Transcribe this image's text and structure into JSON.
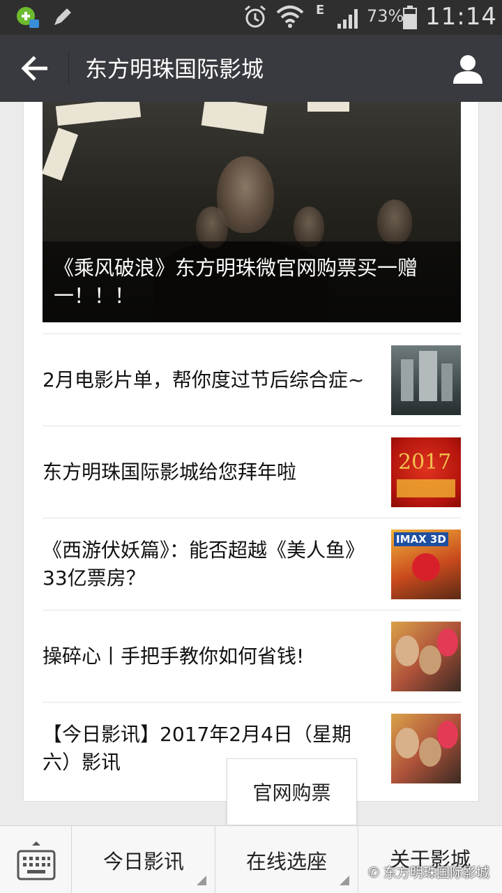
{
  "status_bar": {
    "network_label": "E",
    "battery_percent": "73%",
    "time": "11:14"
  },
  "header": {
    "title": "东方明珠国际影城"
  },
  "banner": {
    "caption": "《乘风破浪》东方明珠微官网购票买一赠一！！！"
  },
  "articles": [
    {
      "title": "2月电影片单，帮你度过节后综合症~",
      "thumb_icon": "city-poster-thumbnail"
    },
    {
      "title": "东方明珠国际影城给您拜年啦",
      "thumb_icon": "new-year-2017-thumbnail",
      "thumb_text": "2017"
    },
    {
      "title": "《西游伏妖篇》：能否超越《美人鱼》33亿票房？",
      "thumb_icon": "movie-poster-thumbnail",
      "thumb_text": "IMAX 3D"
    },
    {
      "title": "操碎心丨手把手教你如何省钱!",
      "thumb_icon": "movie-cast-thumbnail"
    },
    {
      "title": "【今日影讯】2017年2月4日（星期六）影讯",
      "thumb_icon": "movie-cast-thumbnail"
    }
  ],
  "popup_menu": {
    "item": "官网购票"
  },
  "bottom_menu": {
    "tabs": [
      "今日影讯",
      "在线选座",
      "关于影城"
    ]
  },
  "watermark": "东方明珠国际影城",
  "colors": {
    "header_bg": "#393a3f",
    "status_bg": "#2f2f2f",
    "page_bg": "#ebebeb"
  }
}
